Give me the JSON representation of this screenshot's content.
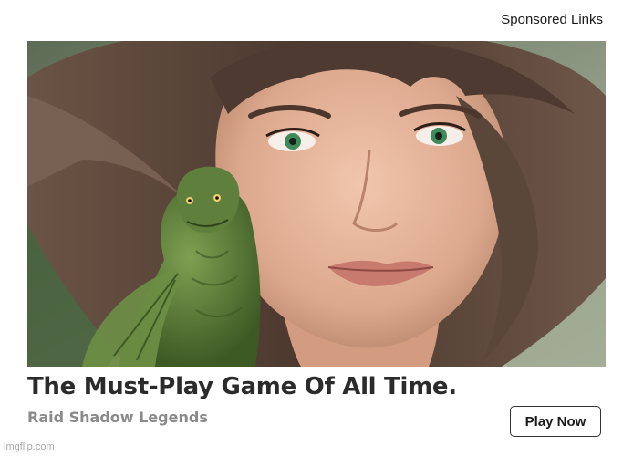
{
  "header": {
    "sponsored_label": "Sponsored Links"
  },
  "ad": {
    "headline": "The Must-Play Game Of All Time.",
    "advertiser": "Raid Shadow Legends",
    "cta_label": "Play Now",
    "image_icon": "woman-with-green-dragon-image"
  },
  "footer": {
    "watermark": "imgflip.com"
  },
  "colors": {
    "headline": "#2b2b2b",
    "advertiser": "#8a8a8a",
    "cta_border": "#333333",
    "hair": "#5a4438",
    "skin": "#e6b39a",
    "dragon": "#5f7f3c",
    "eyes": "#3f8a5a"
  }
}
